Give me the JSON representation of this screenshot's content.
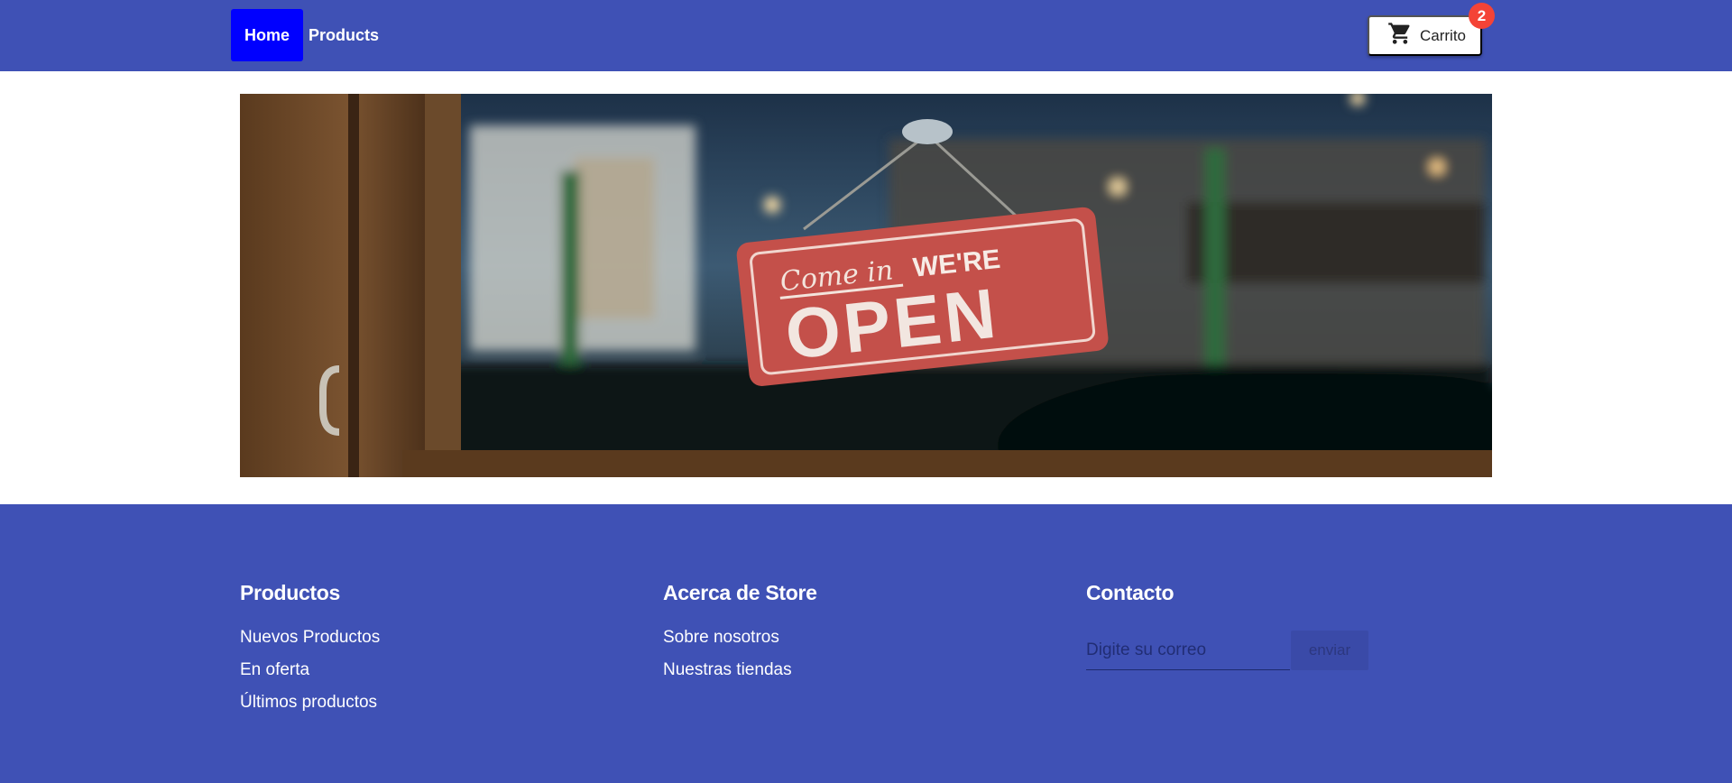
{
  "nav": {
    "home_label": "Home",
    "products_label": "Products"
  },
  "cart": {
    "label": "Carrito",
    "count": "2",
    "icon": "shopping-cart-icon"
  },
  "hero": {
    "sign_small": "Come in",
    "sign_line1": "WE'RE",
    "sign_big": "OPEN"
  },
  "footer": {
    "productos": {
      "heading": "Productos",
      "links": [
        "Nuevos Productos",
        "En oferta",
        "Últimos productos"
      ]
    },
    "acerca": {
      "heading": "Acerca de Store",
      "links": [
        "Sobre nosotros",
        "Nuestras tiendas"
      ]
    },
    "contacto": {
      "heading": "Contacto",
      "email_placeholder": "Digite su correo",
      "send_label": "enviar"
    }
  },
  "colors": {
    "primary": "#3f51b5",
    "home_active": "#0000ff",
    "badge": "#f44336"
  }
}
